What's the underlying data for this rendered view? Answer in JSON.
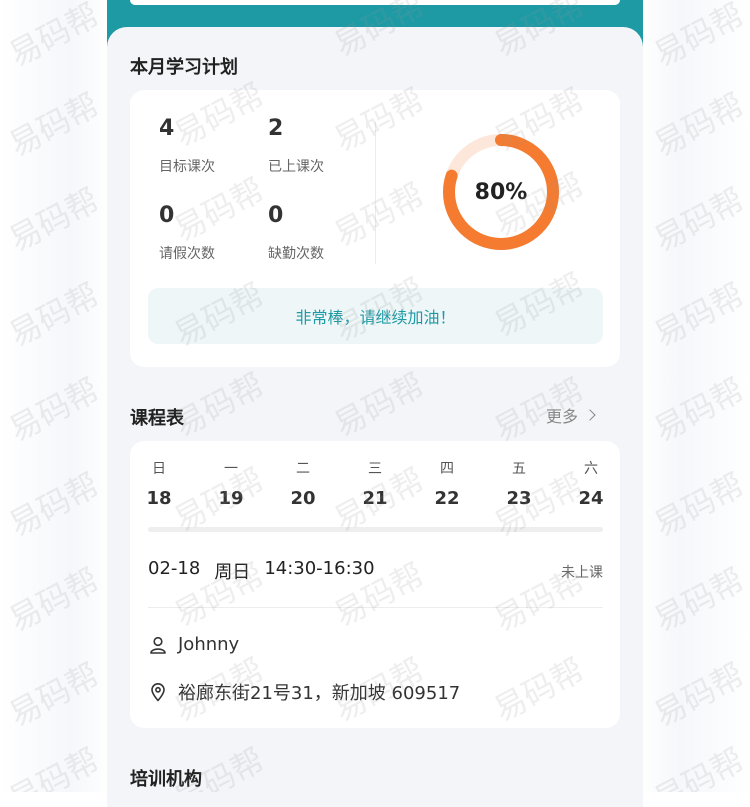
{
  "study_plan": {
    "title": "本月学习计划",
    "stats": [
      {
        "value": "4",
        "label": "目标课次"
      },
      {
        "value": "2",
        "label": "已上课次"
      },
      {
        "value": "0",
        "label": "请假次数"
      },
      {
        "value": "0",
        "label": "缺勤次数"
      }
    ],
    "progress_text": "80%",
    "progress_fraction": 0.8,
    "encouragement": "非常棒，请继续加油！"
  },
  "schedule": {
    "title": "课程表",
    "more_label": "更多",
    "week": [
      {
        "day": "日",
        "date": "18"
      },
      {
        "day": "一",
        "date": "19"
      },
      {
        "day": "二",
        "date": "20"
      },
      {
        "day": "三",
        "date": "21"
      },
      {
        "day": "四",
        "date": "22"
      },
      {
        "day": "五",
        "date": "23"
      },
      {
        "day": "六",
        "date": "24"
      }
    ],
    "session": {
      "date": "02-18",
      "weekday": "周日",
      "time": "14:30-16:30",
      "status": "未上课",
      "teacher": "Johnny",
      "address": "裕廊东街21号31，新加坡 609517"
    }
  },
  "institution": {
    "title": "培训机构"
  },
  "watermark": "易码帮",
  "colors": {
    "accent": "#1e9aa4",
    "progress": "#f47b30",
    "progress_track": "#fde7db"
  },
  "icons": {
    "more": "chevron-right-icon",
    "teacher": "user-icon",
    "address": "location-pin-icon"
  }
}
